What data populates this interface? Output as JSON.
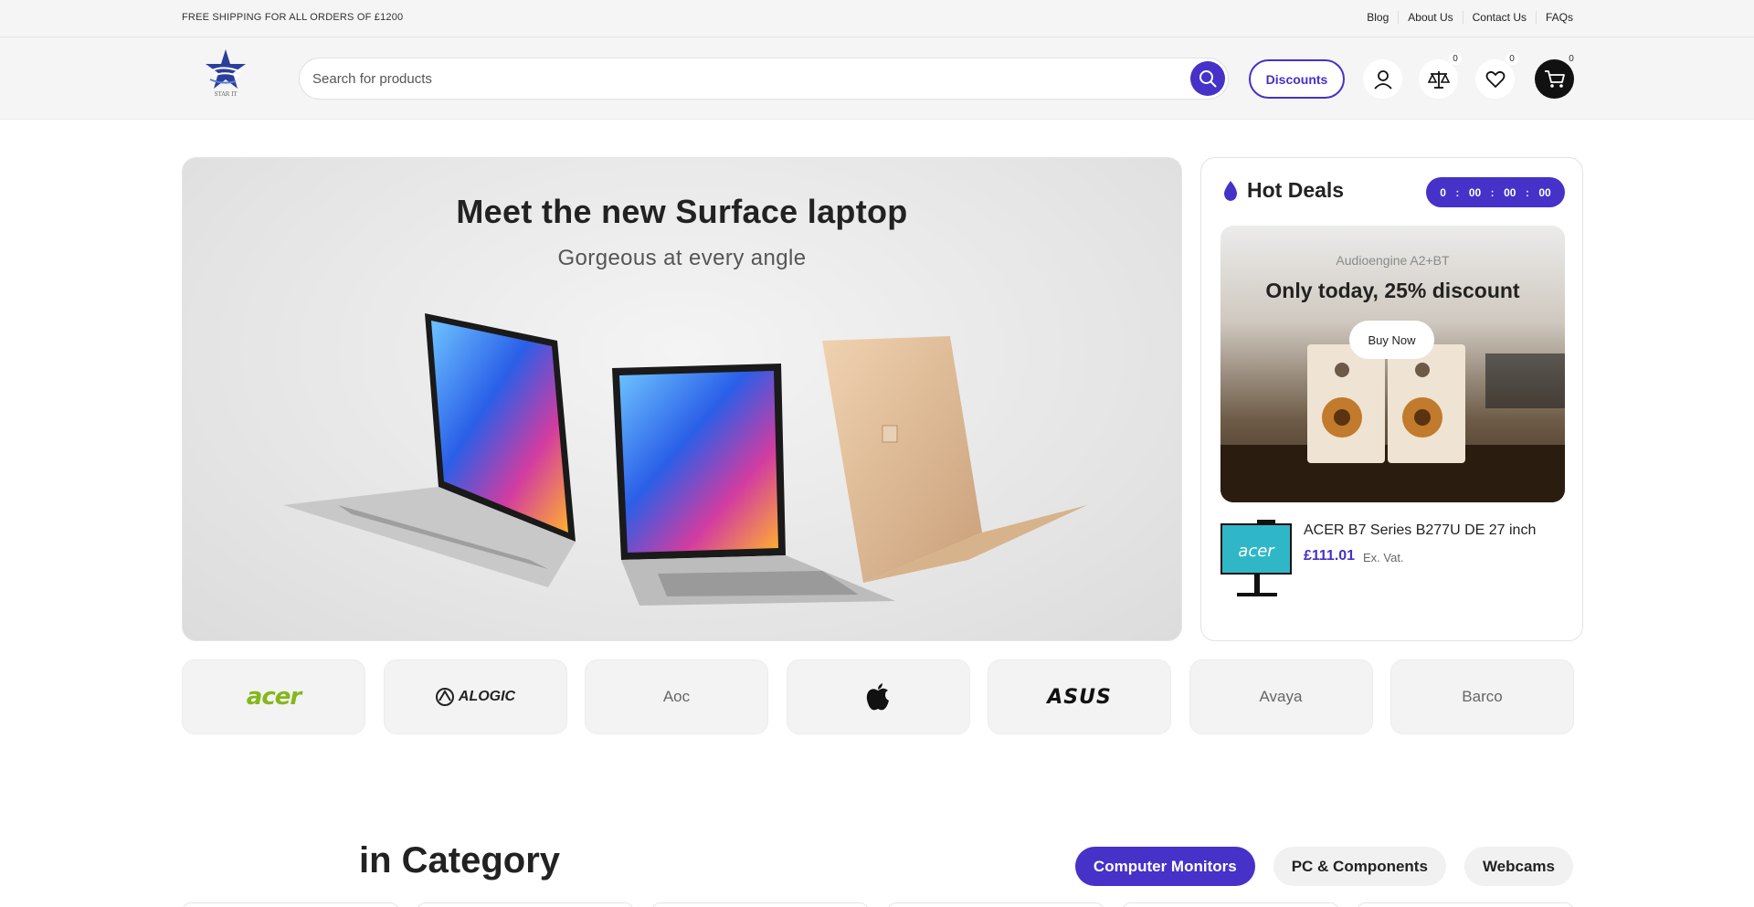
{
  "topbar": {
    "shipping_text": "FREE SHIPPING FOR ALL ORDERS OF £1200",
    "links": [
      "Blog",
      "About Us",
      "Contact Us",
      "FAQs"
    ]
  },
  "header": {
    "logo_icon": "star-logo",
    "logo_text": "STAR IT",
    "search_placeholder": "Search for products",
    "discounts_label": "Discounts",
    "compare_count": "0",
    "wishlist_count": "0",
    "cart_count": "0"
  },
  "hero": {
    "title": "Meet the new Surface laptop",
    "subtitle": "Gorgeous at every angle"
  },
  "hot_deals": {
    "title": "Hot Deals",
    "timer": [
      "0",
      "00",
      "00",
      "00"
    ],
    "promo": {
      "subtitle": "Audioengine A2+BT",
      "title": "Only today, 25% discount",
      "button": "Buy Now"
    },
    "product": {
      "name": "ACER B7 Series B277U DE 27 inch",
      "price": "£111.01",
      "vat": "Ex. Vat."
    }
  },
  "brands": [
    "acer",
    "ALOGIC",
    "Aoc",
    "apple",
    "ASUS",
    "Avaya",
    "Barco"
  ],
  "category": {
    "title": "in Category",
    "tabs": [
      "Computer Monitors",
      "PC & Components",
      "Webcams"
    ],
    "active_tab": 0
  },
  "colors": {
    "accent": "#4631c9",
    "acer_green": "#83b81a"
  }
}
